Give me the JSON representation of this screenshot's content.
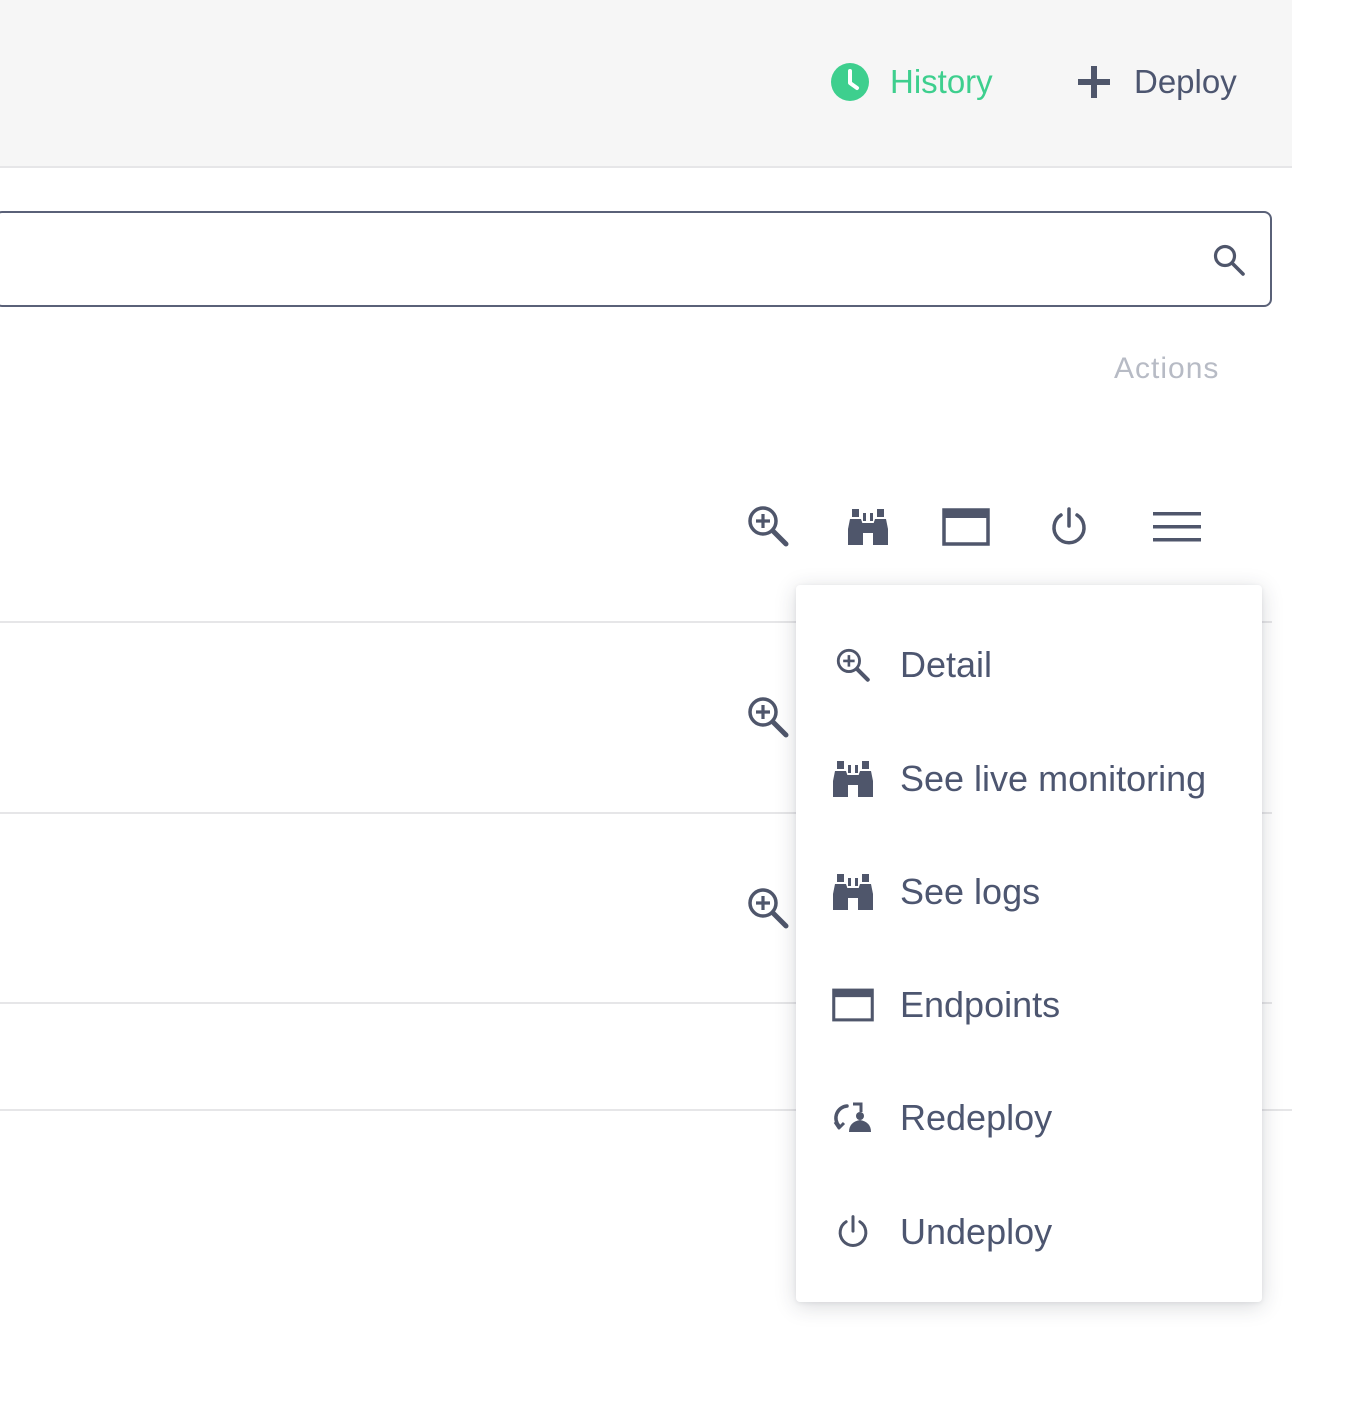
{
  "header": {
    "history_label": "History",
    "deploy_label": "Deploy",
    "history_color": "#3ecf8e",
    "history_icon": "clock-icon",
    "deploy_icon": "plus-icon"
  },
  "search": {
    "value": "",
    "placeholder": "",
    "icon": "search-icon"
  },
  "table": {
    "actions_header": "Actions",
    "row_actions": [
      "zoom-in-icon",
      "binoculars-icon",
      "window-icon",
      "power-icon",
      "hamburger-menu-icon"
    ]
  },
  "menu": {
    "items": [
      {
        "label": "Detail",
        "icon": "zoom-in-icon"
      },
      {
        "label": "See live monitoring",
        "icon": "binoculars-icon"
      },
      {
        "label": "See logs",
        "icon": "binoculars-icon"
      },
      {
        "label": "Endpoints",
        "icon": "window-icon"
      },
      {
        "label": "Redeploy",
        "icon": "redeploy-icon"
      },
      {
        "label": "Undeploy",
        "icon": "power-icon"
      }
    ]
  },
  "colors": {
    "accent": "#3ecf8e",
    "text": "#4d5670",
    "muted": "#b7bbc5",
    "icon": "#4f566b"
  }
}
